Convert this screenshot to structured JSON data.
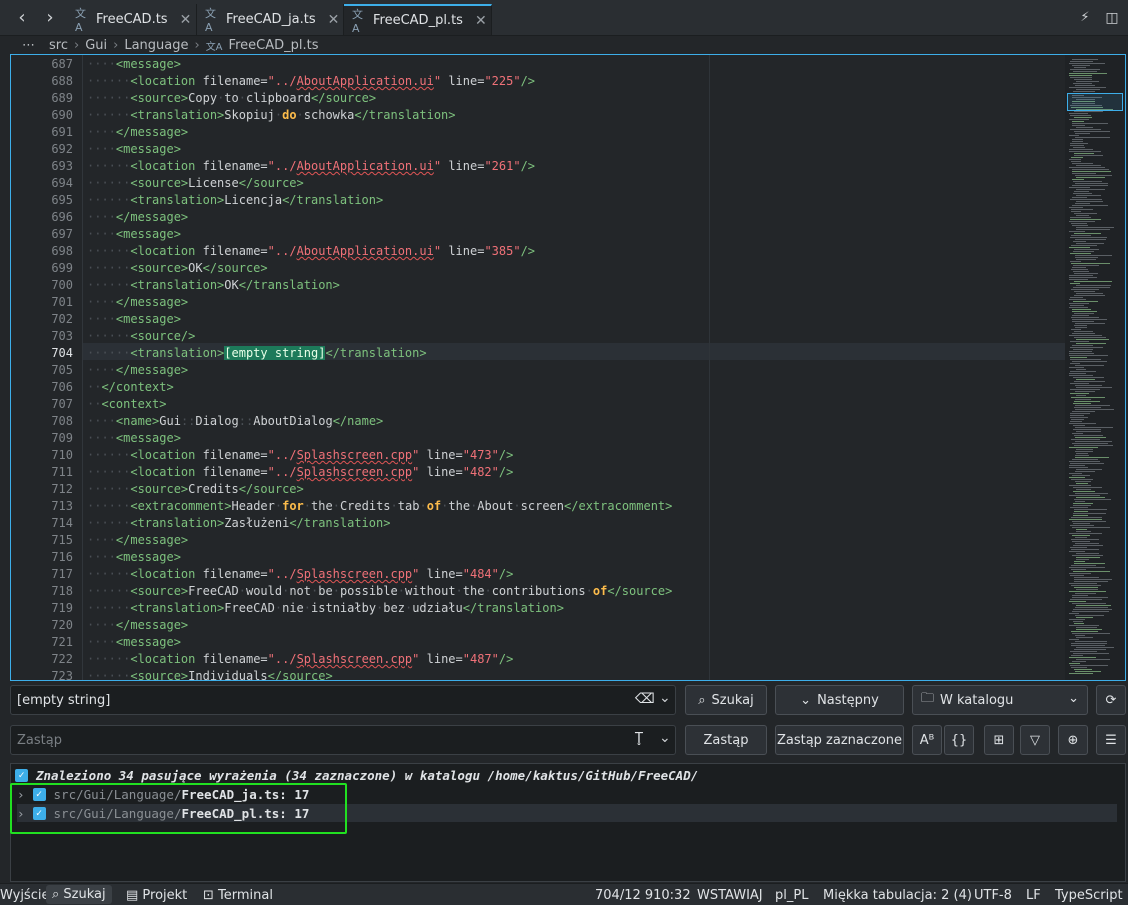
{
  "tabs": [
    {
      "label": "FreeCAD.ts",
      "icon": "translate-icon"
    },
    {
      "label": "FreeCAD_ja.ts",
      "icon": "translate-icon"
    },
    {
      "label": "FreeCAD_pl.ts",
      "icon": "translate-icon",
      "active": true
    }
  ],
  "breadcrumb": [
    "src",
    "Gui",
    "Language",
    "FreeCAD_pl.ts"
  ],
  "editor": {
    "current_line": "704",
    "line_numbers": [
      "687",
      "688",
      "689",
      "690",
      "691",
      "692",
      "693",
      "694",
      "695",
      "696",
      "697",
      "698",
      "699",
      "700",
      "701",
      "702",
      "703",
      "704",
      "705",
      "706",
      "707",
      "708",
      "709",
      "710",
      "711",
      "712",
      "713",
      "714",
      "715",
      "716",
      "717",
      "718",
      "719",
      "720",
      "721",
      "722",
      "723"
    ]
  },
  "search": {
    "value": "[empty string]",
    "search_button": "Szukaj",
    "next_button": "Następny",
    "scope": "W katalogu",
    "replace_placeholder": "Zastąp",
    "replace_button": "Zastąp",
    "replace_selected_button": "Zastąp zaznaczone"
  },
  "results": {
    "summary": "Znaleziono 34 pasujące wyrażenia (34 zaznaczone) w katalogu /home/kaktus/GitHub/FreeCAD/",
    "files": [
      {
        "path": "src/Gui/Language/",
        "name": "FreeCAD_ja.ts: 17"
      },
      {
        "path": "src/Gui/Language/",
        "name": "FreeCAD_pl.ts: 17"
      }
    ]
  },
  "status": {
    "output": "Wyjście",
    "search": "Szukaj",
    "project": "Projekt",
    "terminal": "Terminal",
    "cursor": "704/12 910:32",
    "mode": "WSTAWIAJ",
    "lang": "pl_PL",
    "tabs": "Miękka tabulacja: 2 (4)",
    "encoding": "UTF-8",
    "eol": "LF",
    "syntax": "TypeScript"
  },
  "colors": {
    "accent": "#3daee9",
    "highlight": "#1d7a5a",
    "annotation": "#21e021"
  }
}
